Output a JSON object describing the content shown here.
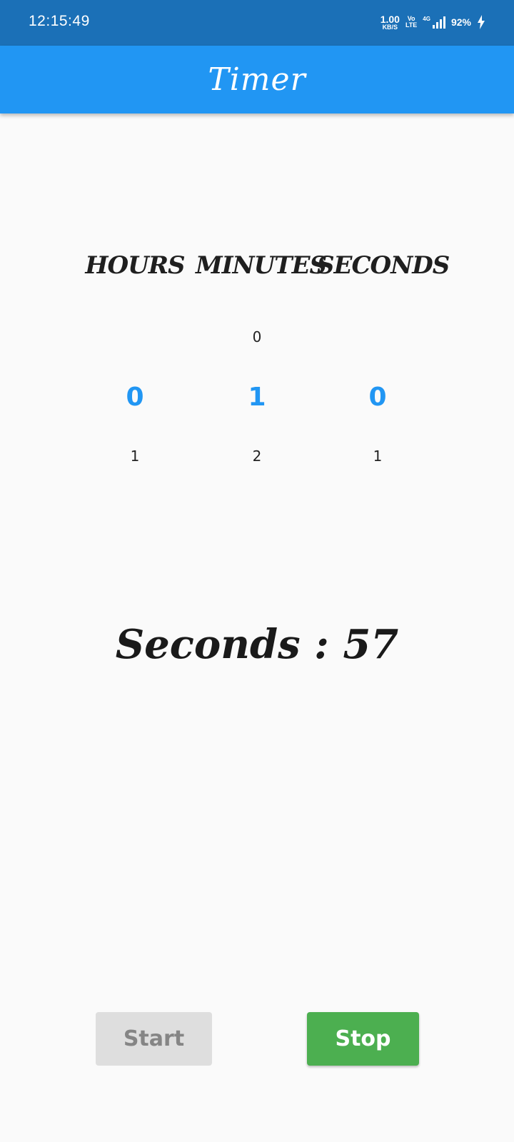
{
  "status_bar": {
    "time": "12:15:49",
    "net_speed_value": "1.00",
    "net_speed_unit": "KB/S",
    "volte_top": "Vo",
    "volte_bottom": "LTE",
    "network": "4G",
    "battery": "92%"
  },
  "app_bar": {
    "title": "Timer"
  },
  "picker": {
    "headers": [
      "HOURS",
      "MINUTES",
      "SECONDS"
    ],
    "hours": {
      "prev": "",
      "selected": "0",
      "next": "1"
    },
    "minutes": {
      "prev": "0",
      "selected": "1",
      "next": "2"
    },
    "seconds": {
      "prev": "",
      "selected": "0",
      "next": "1"
    }
  },
  "display": {
    "text": "Seconds : 57"
  },
  "buttons": {
    "start": "Start",
    "stop": "Stop"
  },
  "colors": {
    "status_bar": "#1b70b7",
    "primary": "#2196f3",
    "stop": "#4caf50",
    "start_disabled": "#dedede"
  }
}
